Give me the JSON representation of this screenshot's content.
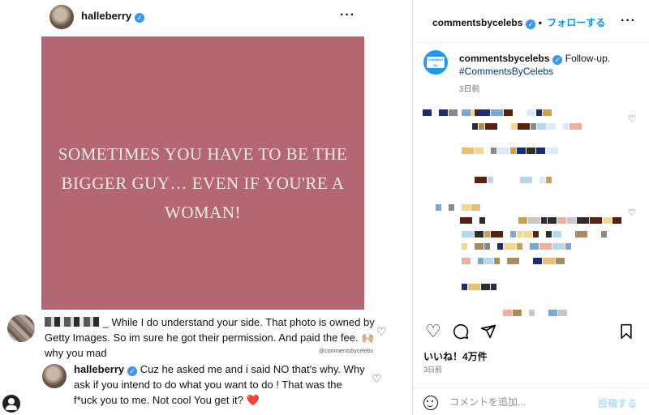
{
  "left_post": {
    "username": "halleberry",
    "menu_icon": "more-dots-icon",
    "image_text": "SOMETIMES YOU HAVE TO BE THE BIGGER GUY… EVEN IF YOU'RE A WOMAN!",
    "comments": [
      {
        "suffix": "_ While I do understand your side.  That photo is owned by Getty Images. So im sure he got their permission. And paid the fee. 🙌🏼 why you mad"
      },
      {
        "username": "halleberry",
        "text": "Cuz he asked me and i said NO that's why. Why ask if you intend to do what you want to do ! That was the f*uck you to me. Not cool You get it?",
        "emoji": "❤️"
      }
    ],
    "credit": "@commentsbycelebs"
  },
  "sidebar": {
    "header": {
      "account": "commentsbycelebs",
      "separator": " • ",
      "follow_label": "フォローする",
      "menu_icon": "more-dots-icon"
    },
    "caption": {
      "account": "commentsbycelebs",
      "text": "Follow-up.",
      "hashtag": "#CommentsByCelebs",
      "time": "3日前"
    },
    "actions": [
      "heart-icon",
      "comment-icon",
      "share-icon",
      "bookmark-icon"
    ],
    "likes": "いいね！4万件",
    "posted": "3日前",
    "comment_placeholder": "コメントを追加...",
    "post_label": "投稿する"
  },
  "colors": {
    "post_background": "#b36772",
    "link_blue": "#0095f6",
    "verified_blue": "#3897f0"
  }
}
